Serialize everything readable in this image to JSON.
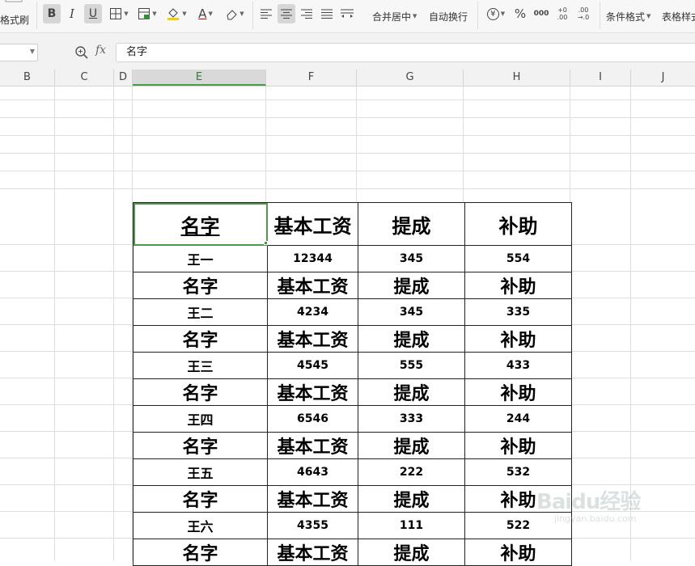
{
  "toolbar": {
    "format_painter": "格式刷",
    "bold": "B",
    "italic": "I",
    "underline": "U",
    "font_color_glyph": "A",
    "merge_center": "合并居中",
    "wrap_text": "自动换行",
    "currency_glyph": "¥",
    "percent_glyph": "%",
    "thousands_glyph": "000",
    "inc_decimal": "+0 .00",
    "dec_decimal": ".00 →.0",
    "conditional_format": "条件格式",
    "table_style": "表格样式"
  },
  "formula_bar": {
    "name_box": "",
    "fx": "fx",
    "value": "名字"
  },
  "columns": [
    {
      "label": "B",
      "active": false
    },
    {
      "label": "C",
      "active": false
    },
    {
      "label": "D",
      "active": false
    },
    {
      "label": "E",
      "active": true
    },
    {
      "label": "F",
      "active": false
    },
    {
      "label": "G",
      "active": false
    },
    {
      "label": "H",
      "active": false
    },
    {
      "label": "I",
      "active": false
    },
    {
      "label": "J",
      "active": false
    }
  ],
  "table": {
    "header": [
      "名字",
      "基本工资",
      "提成",
      "补助"
    ],
    "rows": [
      {
        "name": "王一",
        "base": "12344",
        "commission": "345",
        "allowance": "554"
      },
      {
        "name": "王二",
        "base": "4234",
        "commission": "345",
        "allowance": "335"
      },
      {
        "name": "王三",
        "base": "4545",
        "commission": "555",
        "allowance": "433"
      },
      {
        "name": "王四",
        "base": "6546",
        "commission": "333",
        "allowance": "244"
      },
      {
        "name": "王五",
        "base": "4643",
        "commission": "222",
        "allowance": "532"
      },
      {
        "name": "王六",
        "base": "4355",
        "commission": "111",
        "allowance": "522"
      }
    ]
  },
  "watermark": {
    "logo": "Baidu经验",
    "url": "jingyan.baidu.com"
  }
}
